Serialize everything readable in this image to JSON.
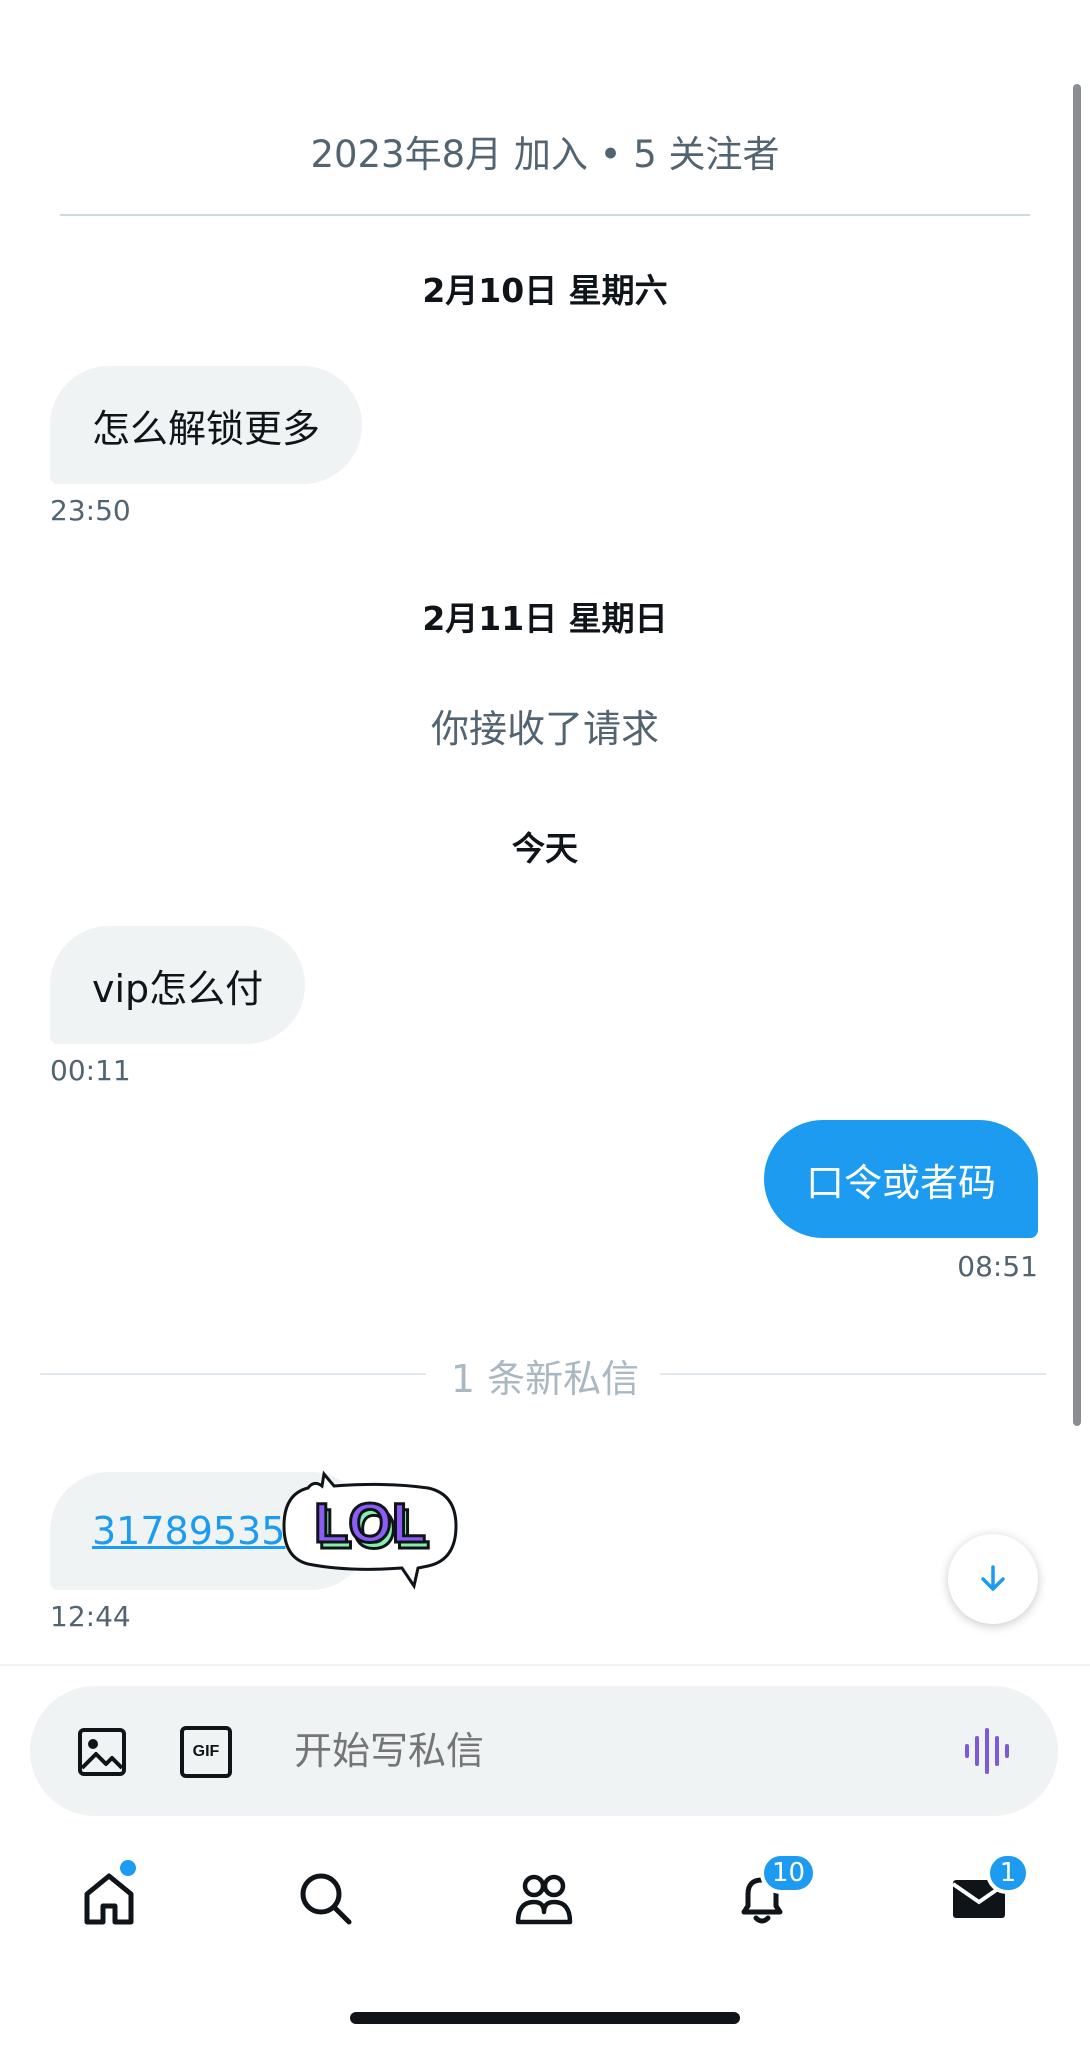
{
  "profile": {
    "joined_text": "2023年8月 加入 • 5 关注者"
  },
  "messages": [
    {
      "type": "date",
      "text": "2月10日 星期六"
    },
    {
      "type": "incoming",
      "text": "怎么解锁更多",
      "time": "23:50"
    },
    {
      "type": "date",
      "text": "2月11日 星期日"
    },
    {
      "type": "system",
      "text": "你接收了请求"
    },
    {
      "type": "date",
      "text": "今天"
    },
    {
      "type": "incoming",
      "text": "vip怎么付",
      "time": "00:11"
    },
    {
      "type": "outgoing",
      "text": "口令或者码",
      "time": "08:51"
    },
    {
      "type": "divider",
      "text": "1 条新私信"
    },
    {
      "type": "incoming",
      "text": "31789535",
      "time": "12:44",
      "sticker": "LOL"
    }
  ],
  "composer": {
    "placeholder": "开始写私信",
    "gif_label": "GIF"
  },
  "tabs": {
    "notifications_badge": "10",
    "messages_badge": "1"
  },
  "colors": {
    "accent": "#1d9bf0",
    "bubble_in": "#eff3f4",
    "voice_icon": "#7b59d8",
    "sticker_purple": "#8b5cf6",
    "sticker_green": "#86efac"
  }
}
